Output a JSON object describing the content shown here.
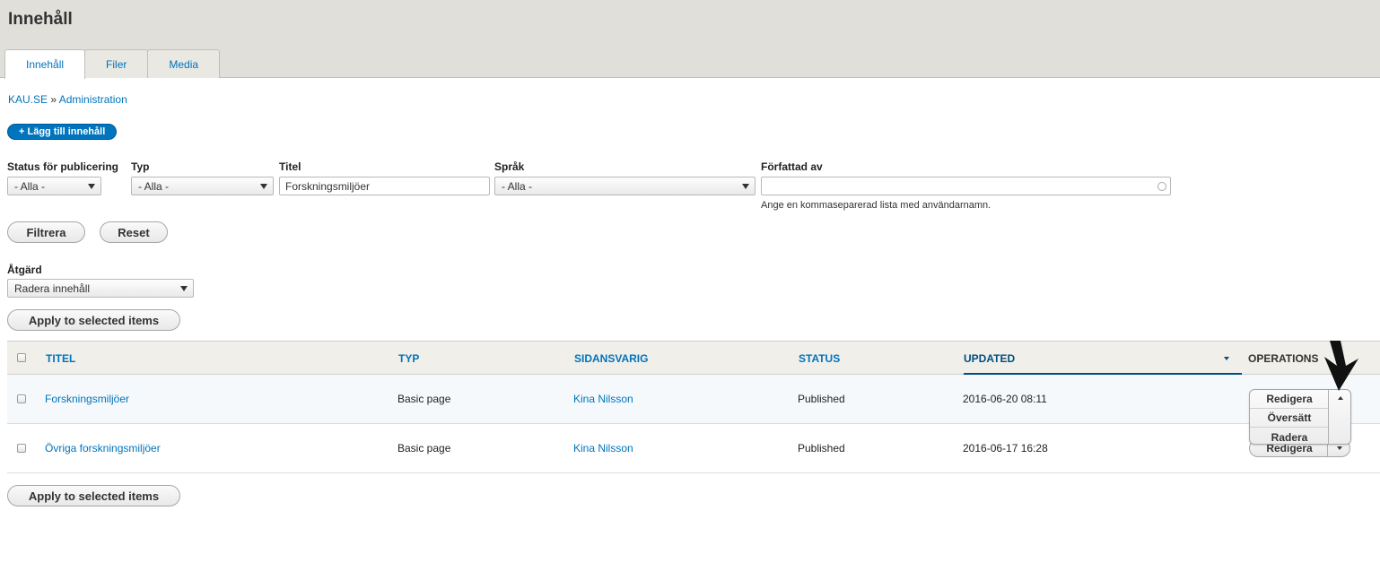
{
  "header": {
    "title": "Innehåll",
    "tabs": [
      {
        "label": "Innehåll",
        "active": true
      },
      {
        "label": "Filer",
        "active": false
      },
      {
        "label": "Media",
        "active": false
      }
    ]
  },
  "breadcrumb": {
    "items": [
      "KAU.SE",
      "Administration"
    ],
    "separator": "»"
  },
  "add_button": {
    "label": "+ Lägg till innehåll"
  },
  "filters": {
    "status": {
      "label": "Status för publicering",
      "value": "- Alla -"
    },
    "type": {
      "label": "Typ",
      "value": "- Alla -"
    },
    "title": {
      "label": "Titel",
      "value": "Forskningsmiljöer"
    },
    "language": {
      "label": "Språk",
      "value": "- Alla -"
    },
    "author": {
      "label": "Författad av",
      "value": "",
      "help": "Ange en kommaseparerad lista med användarnamn."
    },
    "filter_button": "Filtrera",
    "reset_button": "Reset"
  },
  "bulk": {
    "label": "Åtgärd",
    "value": "Radera innehåll",
    "apply_button": "Apply to selected items"
  },
  "table": {
    "columns": [
      "TITEL",
      "TYP",
      "SIDANSVARIG",
      "STATUS",
      "UPDATED",
      "OPERATIONS"
    ],
    "rows": [
      {
        "title": "Forskningsmiljöer",
        "type": "Basic page",
        "owner": "Kina Nilsson",
        "status": "Published",
        "updated": "2016-06-20 08:11",
        "op": "Redigera"
      },
      {
        "title": "Övriga forskningsmiljöer",
        "type": "Basic page",
        "owner": "Kina Nilsson",
        "status": "Published",
        "updated": "2016-06-17 16:28",
        "op": "Redigera"
      }
    ],
    "dropdown_items": [
      "Redigera",
      "Översätt",
      "Radera"
    ]
  },
  "bottom": {
    "apply_button": "Apply to selected items"
  },
  "colors": {
    "link": "#0074bd",
    "primary_button": "#0074bd",
    "header_bg": "#e0dfd9"
  }
}
